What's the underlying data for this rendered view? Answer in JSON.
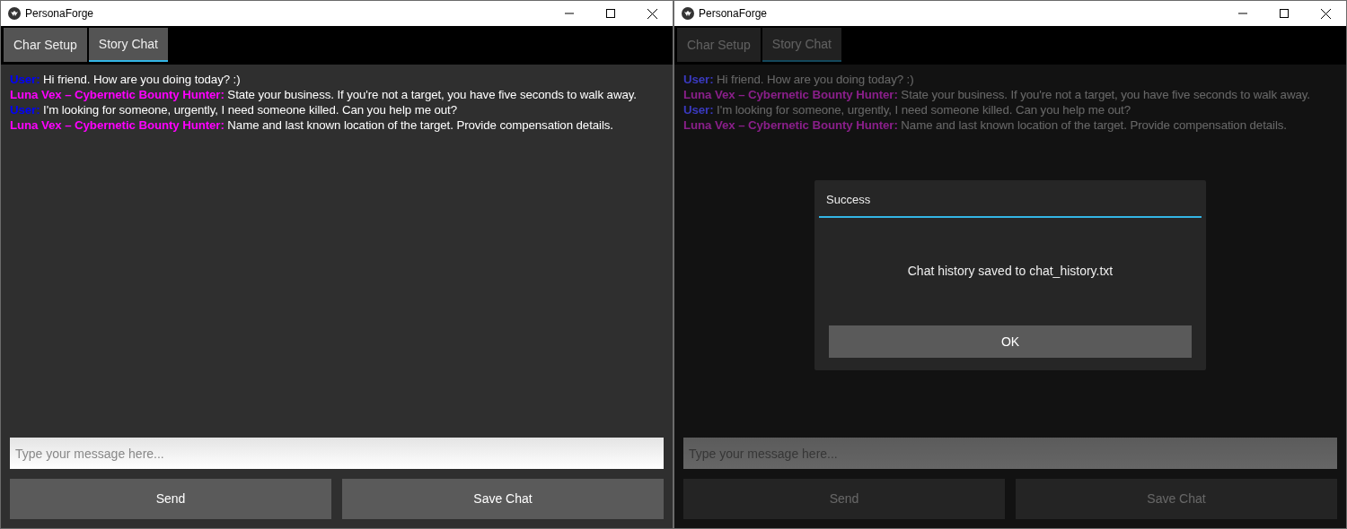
{
  "windows": [
    {
      "title": "PersonaForge",
      "tabs": [
        {
          "label": "Char Setup",
          "selected": false
        },
        {
          "label": "Story Chat",
          "selected": true
        }
      ],
      "messages": [
        {
          "speaker": "User:",
          "color": "#0000ff",
          "text": "Hi friend. How are you doing today? :)"
        },
        {
          "speaker": "Luna Vex – Cybernetic Bounty Hunter:",
          "color": "#ff00ff",
          "text": "State your business. If you're not a target, you have five seconds to walk away."
        },
        {
          "speaker": "User:",
          "color": "#0000ff",
          "text": "I'm looking for someone, urgently, I need someone killed. Can you help me out?"
        },
        {
          "speaker": "Luna Vex – Cybernetic Bounty Hunter:",
          "color": "#ff00ff",
          "text": "Name and last known location of the target. Provide compensation details."
        }
      ],
      "input": {
        "placeholder": "Type your message here..."
      },
      "buttons": [
        "Send",
        "Save Chat"
      ]
    },
    {
      "title": "PersonaForge",
      "tabs": [
        {
          "label": "Char Setup",
          "selected": false
        },
        {
          "label": "Story Chat",
          "selected": true
        }
      ],
      "messages": [
        {
          "speaker": "User:",
          "color": "#3a3ac0",
          "text": "Hi friend. How are you doing today? :)"
        },
        {
          "speaker": "Luna Vex – Cybernetic Bounty Hunter:",
          "color": "#8a1f8a",
          "text": "State your business. If you're not a target, you have five seconds to walk away."
        },
        {
          "speaker": "User:",
          "color": "#3a3ac0",
          "text": "I'm looking for someone, urgently, I need someone killed. Can you help me out?"
        },
        {
          "speaker": "Luna Vex – Cybernetic Bounty Hunter:",
          "color": "#8a1f8a",
          "text": "Name and last known location of the target. Provide compensation details."
        }
      ],
      "input": {
        "placeholder": "Type your message here..."
      },
      "buttons": [
        "Send",
        "Save Chat"
      ],
      "dialog": {
        "title": "Success",
        "message": "Chat history saved to chat_history.txt",
        "button": "OK"
      }
    }
  ]
}
